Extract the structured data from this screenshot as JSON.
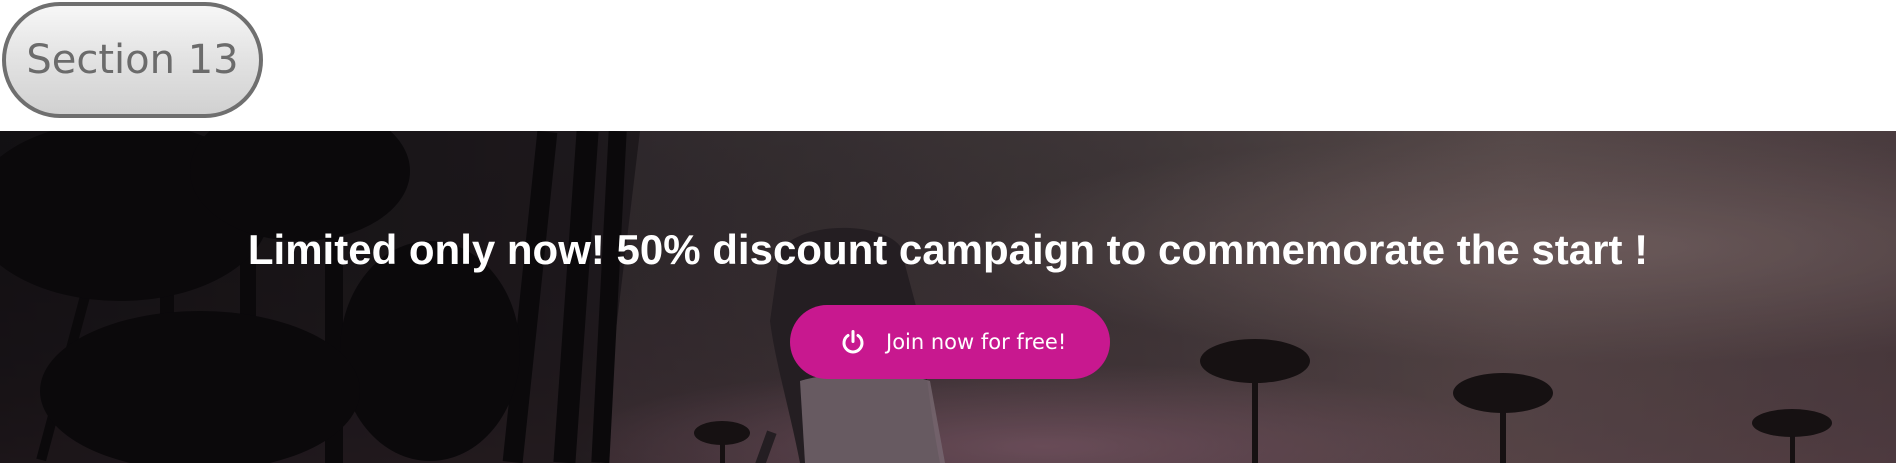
{
  "section_badge": {
    "label": "Section 13"
  },
  "hero": {
    "headline": "Limited only now! 50% discount campaign to commemorate the start !",
    "cta": {
      "label": "Join now for free!",
      "icon": "power-icon"
    },
    "background": {
      "subject": "palm-trees-sunset-photo"
    }
  },
  "colors": {
    "cta": "#c8188f",
    "badge_border": "#6f6f6f",
    "badge_text": "#6b6b6b",
    "headline": "#ffffff"
  }
}
